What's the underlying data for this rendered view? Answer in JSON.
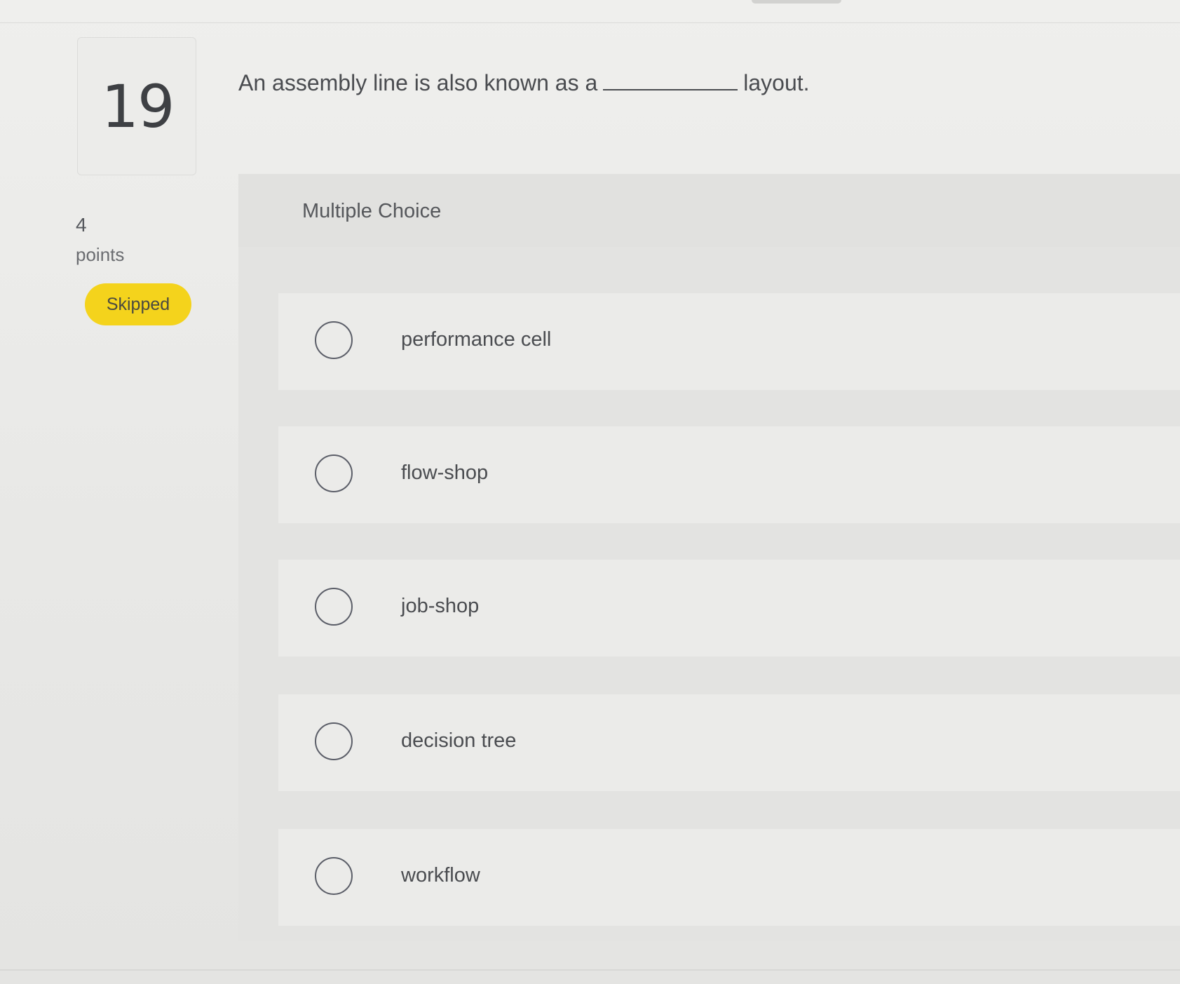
{
  "question": {
    "number": "19",
    "text_before": "An assembly line is also known as a",
    "text_after": "layout.",
    "points_value": "4",
    "points_label": "points",
    "status": "Skipped"
  },
  "answer_section": {
    "type_label": "Multiple Choice",
    "options": [
      {
        "label": "performance cell",
        "selected": false
      },
      {
        "label": "flow-shop",
        "selected": false
      },
      {
        "label": "job-shop",
        "selected": false
      },
      {
        "label": "decision tree",
        "selected": false
      },
      {
        "label": "workflow",
        "selected": false
      }
    ]
  },
  "colors": {
    "badge": "#f4d31c",
    "page_background": "#e9e9e7",
    "option_background": "#ebebe9",
    "radio_border": "#5b5e68"
  }
}
